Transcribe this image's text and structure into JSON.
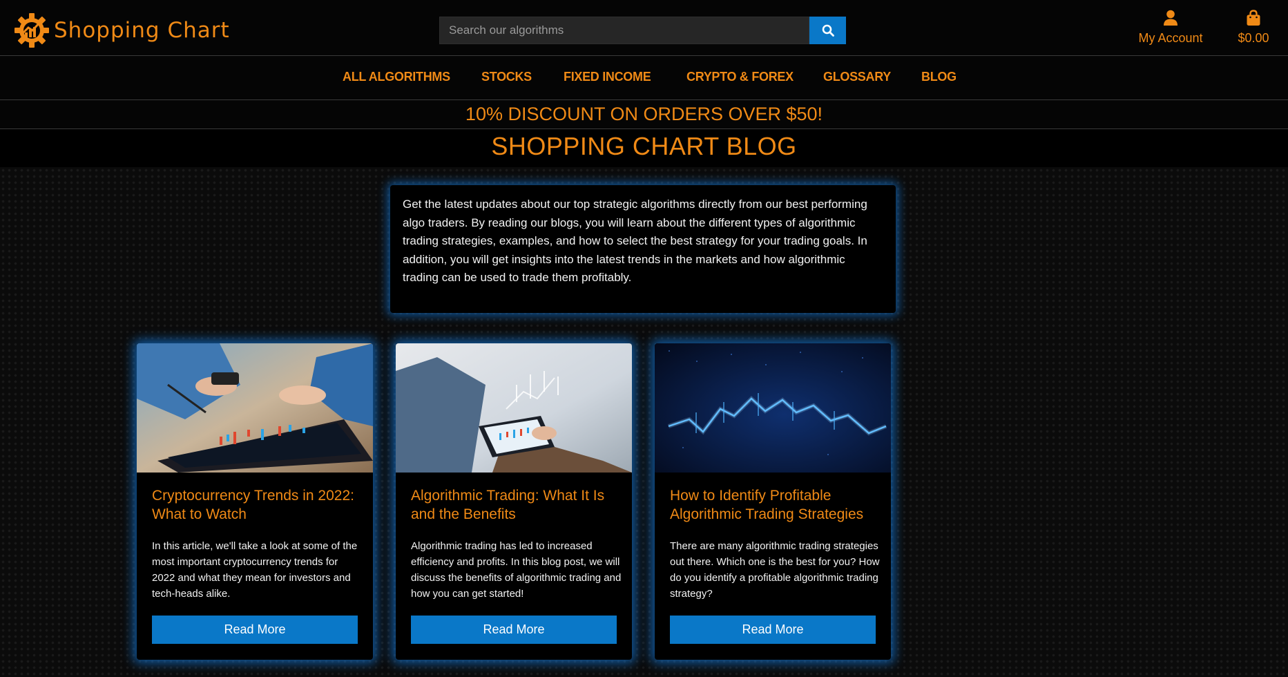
{
  "header": {
    "brand": "Shopping Chart",
    "search_placeholder": "Search our algorithms",
    "account_label": "My Account",
    "cart_total": "$0.00"
  },
  "nav": {
    "items": [
      {
        "label": "ALL ALGORITHMS"
      },
      {
        "label": "STOCKS"
      },
      {
        "label": "FIXED INCOME"
      },
      {
        "label": "CRYPTO & FOREX"
      },
      {
        "label": "GLOSSARY"
      },
      {
        "label": "BLOG"
      }
    ]
  },
  "banner": {
    "discount": "10% DISCOUNT ON ORDERS OVER $50!"
  },
  "page": {
    "title": "SHOPPING CHART BLOG",
    "intro": "Get the latest updates about our top strategic algorithms directly from our best performing algo traders. By reading our blogs, you will learn about the different types of algorithmic trading strategies, examples, and how to select the best strategy for your trading goals. In addition, you will get insights into the latest trends in the markets and how algorithmic trading can be used to trade them profitably."
  },
  "posts": [
    {
      "title": "Cryptocurrency Trends in 2022: What to Watch",
      "excerpt": "In this article, we'll take a look at some of the most important cryptocurrency trends for 2022 and what they mean for investors and tech-heads alike.",
      "button": "Read More"
    },
    {
      "title": "Algorithmic Trading: What It Is and the Benefits",
      "excerpt": "Algorithmic trading has led to increased efficiency and profits. In this blog post, we will discuss the benefits of algorithmic trading and how you can get started!",
      "button": "Read More"
    },
    {
      "title": "How to Identify Profitable Algorithmic Trading Strategies",
      "excerpt": "There are many algorithmic trading strategies out there. Which one is the best for you? How do you identify a profitable algorithmic trading strategy?",
      "button": "Read More"
    }
  ],
  "colors": {
    "accent": "#f08a16",
    "button": "#0a78c8",
    "glow": "#148cff",
    "background": "#050505"
  },
  "icons": [
    "logo-gear-icon",
    "search-icon",
    "user-icon",
    "shopping-bag-icon"
  ]
}
